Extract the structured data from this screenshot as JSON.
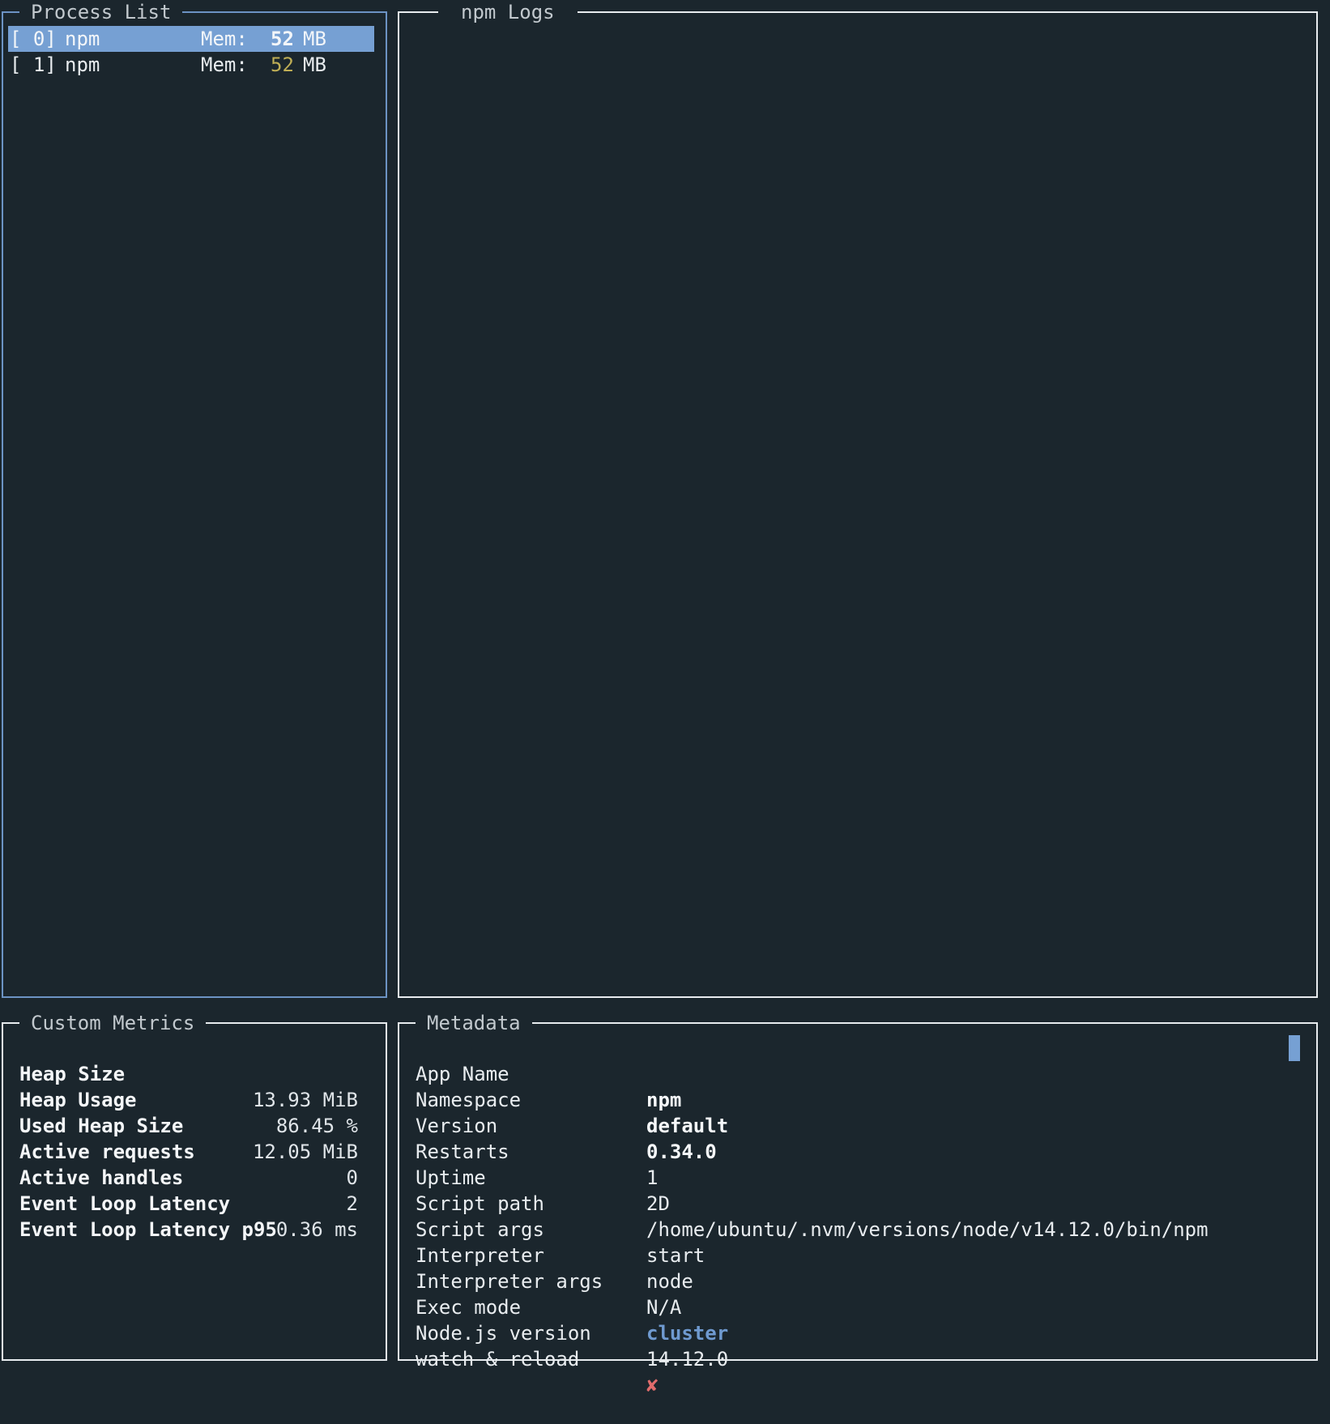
{
  "process_list": {
    "title": "Process List",
    "items": [
      {
        "index": "[ 0]",
        "name": "npm",
        "mem_label": "Mem:",
        "mem_value": "52",
        "mem_unit": "MB",
        "selected": true
      },
      {
        "index": "[ 1]",
        "name": "npm",
        "mem_label": "Mem:",
        "mem_value": "52",
        "mem_unit": "MB",
        "selected": false
      }
    ]
  },
  "logs": {
    "title": "npm Logs"
  },
  "custom_metrics": {
    "title": "Custom Metrics",
    "items": [
      {
        "label": "Heap Size",
        "value": "13.93 MiB"
      },
      {
        "label": "Heap Usage",
        "value": "86.45 %"
      },
      {
        "label": "Used Heap Size",
        "value": "12.05 MiB"
      },
      {
        "label": "Active requests",
        "value": "0"
      },
      {
        "label": "Active handles",
        "value": "2"
      },
      {
        "label": "Event Loop Latency",
        "value": "0.36 ms"
      },
      {
        "label": "Event Loop Latency p95",
        "value": ""
      }
    ]
  },
  "metadata": {
    "title": "Metadata",
    "items": [
      {
        "key": "App Name",
        "value": "npm",
        "style": "bold"
      },
      {
        "key": "Namespace",
        "value": "default",
        "style": "bold"
      },
      {
        "key": "Version",
        "value": "0.34.0",
        "style": "bold"
      },
      {
        "key": "Restarts",
        "value": "1",
        "style": "normal"
      },
      {
        "key": "Uptime",
        "value": "2D",
        "style": "normal"
      },
      {
        "key": "Script path",
        "value": "/home/ubuntu/.nvm/versions/node/v14.12.0/bin/npm",
        "style": "normal"
      },
      {
        "key": "Script args",
        "value": "start",
        "style": "normal"
      },
      {
        "key": "Interpreter",
        "value": "node",
        "style": "normal"
      },
      {
        "key": "Interpreter args",
        "value": "N/A",
        "style": "normal"
      },
      {
        "key": "Exec mode",
        "value": "cluster",
        "style": "accent"
      },
      {
        "key": "Node.js version",
        "value": "14.12.0",
        "style": "normal"
      },
      {
        "key": "watch & reload",
        "value": "✘",
        "style": "cross"
      }
    ]
  },
  "colors": {
    "background": "#1b262d",
    "border": "#e8ecef",
    "focused_border": "#6c93c4",
    "selection": "#76a0d3",
    "warning": "#bfae55",
    "accent": "#6f9ad0",
    "error": "#e06c6c"
  }
}
